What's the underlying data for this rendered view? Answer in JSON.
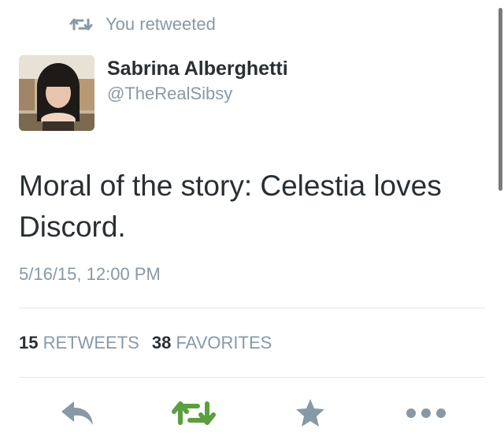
{
  "retweet_context": {
    "label": "You retweeted"
  },
  "author": {
    "display_name": "Sabrina Alberghetti",
    "handle": "@TheRealSibsy"
  },
  "tweet": {
    "text": "Moral of the story: Celestia loves Discord.",
    "timestamp": "5/16/15, 12:00 PM"
  },
  "stats": {
    "retweets": {
      "count": "15",
      "label": "RETWEETS"
    },
    "favorites": {
      "count": "38",
      "label": "FAVORITES"
    }
  },
  "actions": {
    "reply_icon": "reply-icon",
    "retweet_icon": "retweet-icon",
    "favorite_icon": "star-icon",
    "more_icon": "more-icon"
  },
  "colors": {
    "text_primary": "#292f33",
    "text_secondary": "#8899a6",
    "retweeted_green": "#5c9f3e",
    "action_gray": "#8899a6",
    "divider": "#e1e8ed"
  }
}
